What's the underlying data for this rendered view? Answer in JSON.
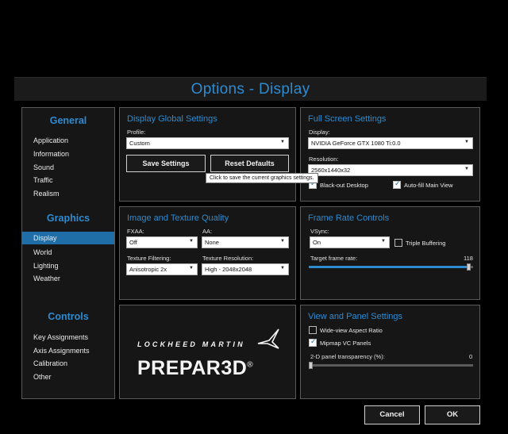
{
  "window": {
    "title": "Options - Display"
  },
  "sidebar": {
    "general": {
      "heading": "General",
      "items": [
        "Application",
        "Information",
        "Sound",
        "Traffic",
        "Realism"
      ]
    },
    "graphics": {
      "heading": "Graphics",
      "items": [
        "Display",
        "World",
        "Lighting",
        "Weather"
      ],
      "active": "Display"
    },
    "controls": {
      "heading": "Controls",
      "items": [
        "Key Assignments",
        "Axis Assignments",
        "Calibration",
        "Other"
      ]
    }
  },
  "global": {
    "title": "Display Global Settings",
    "profile_label": "Profile:",
    "profile_value": "Custom",
    "save_label": "Save Settings",
    "reset_label": "Reset Defaults",
    "tooltip": "Click to save the current graphics settings."
  },
  "fullscreen": {
    "title": "Full Screen Settings",
    "display_label": "Display:",
    "display_value": "NVIDIA GeForce GTX 1080 Ti:0.0",
    "resolution_label": "Resolution:",
    "resolution_value": "2560x1440x32",
    "blackout_label": "Black-out Desktop",
    "blackout_checked": true,
    "autofill_label": "Auto-fill Main View",
    "autofill_checked": true
  },
  "texture": {
    "title": "Image and Texture Quality",
    "fxaa_label": "FXAA:",
    "fxaa_value": "Off",
    "aa_label": "AA:",
    "aa_value": "None",
    "filtering_label": "Texture Filtering:",
    "filtering_value": "Anisotropic 2x",
    "resolution_label": "Texture Resolution:",
    "resolution_value": "High - 2048x2048"
  },
  "framerate": {
    "title": "Frame Rate Controls",
    "vsync_label": "VSync:",
    "vsync_value": "On",
    "triple_label": "Triple Buffering",
    "triple_checked": false,
    "target_label": "Target frame rate:",
    "target_value": "118",
    "target_fraction": 0.97
  },
  "branding": {
    "company": "LOCKHEED MARTIN",
    "product": "PREPAR3D",
    "reg_mark": "®"
  },
  "viewpanel": {
    "title": "View and Panel Settings",
    "wideview_label": "Wide-view Aspect Ratio",
    "wideview_checked": false,
    "mipmap_label": "Mipmap VC Panels",
    "mipmap_checked": true,
    "transparency_label": "2-D panel transparency (%):",
    "transparency_value": "0",
    "transparency_fraction": 0.0
  },
  "footer": {
    "cancel_label": "Cancel",
    "ok_label": "OK"
  },
  "colors": {
    "accent": "#2e8bd0",
    "active_bg": "#1f6ea8",
    "panel_bg": "#161616",
    "border": "#5a5a5a"
  }
}
